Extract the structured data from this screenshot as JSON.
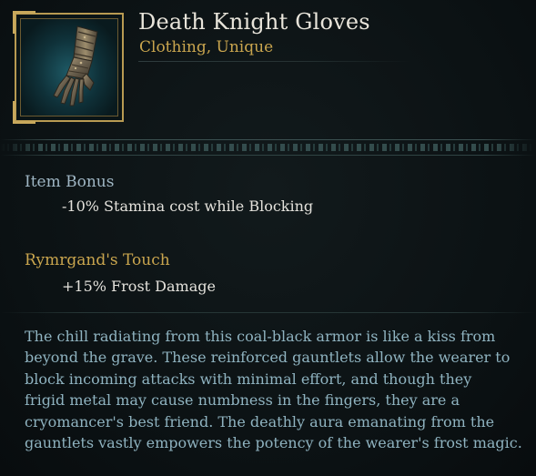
{
  "item": {
    "name": "Death Knight Gloves",
    "type": "Clothing, Unique",
    "icon": "gauntlet-icon"
  },
  "sections": [
    {
      "title": "Item Bonus",
      "value": "-10% Stamina cost while Blocking",
      "title_color": "#9fb6c4"
    },
    {
      "title": "Rymrgand's Touch",
      "value": "+15% Frost Damage",
      "title_color": "#c9a54e"
    }
  ],
  "description": {
    "lines": [
      "The chill radiating from this coal-black armor is like a kiss from",
      "beyond the grave. These reinforced gauntlets allow the wearer to",
      "block incoming attacks with minimal effort, and though they",
      "frigid metal may cause numbness in the fingers, they are a",
      "cryomancer's best friend. The deathly aura emanating from the",
      "gauntlets vastly empowers the potency of the wearer's frost magic."
    ]
  },
  "colors": {
    "background": "#0c1214",
    "gold_accent": "#c9a54e",
    "title_text": "#e8e4da",
    "description_text": "#8fb3c0"
  }
}
